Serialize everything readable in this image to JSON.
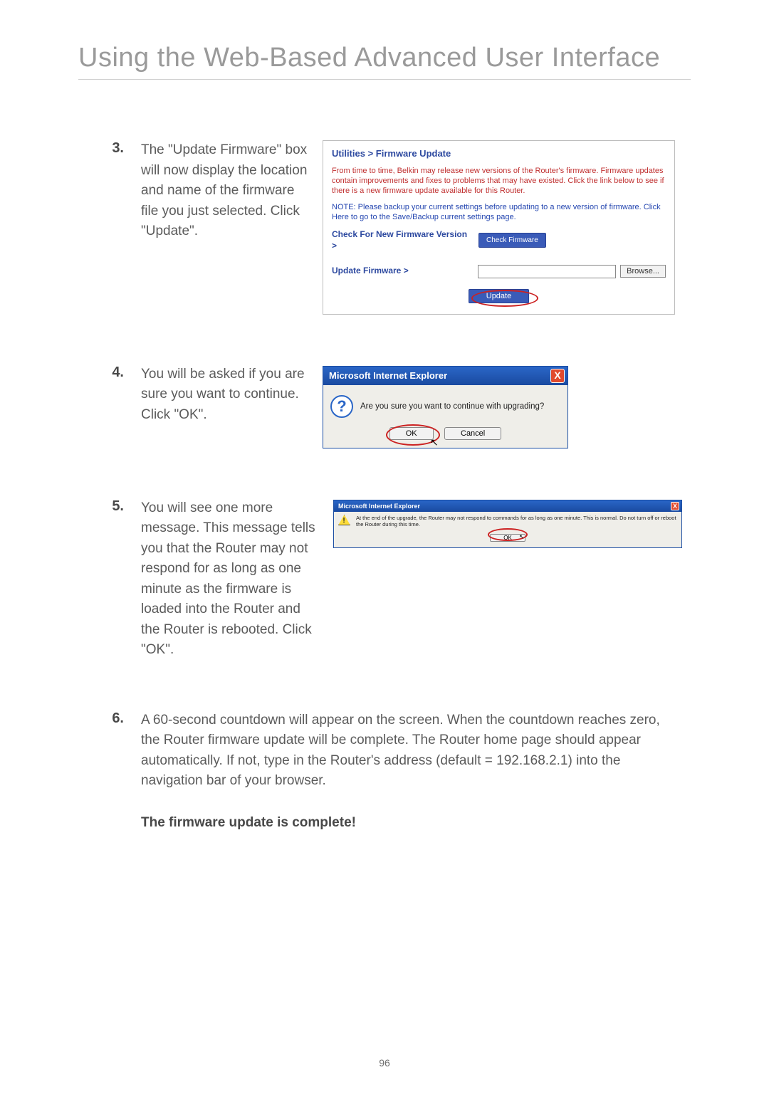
{
  "title": "Using the Web-Based Advanced User Interface",
  "page_number": "96",
  "steps": {
    "s3": {
      "num": "3.",
      "text": "The \"Update Firmware\" box will now display the location and name of the firmware file you just selected. Click \"Update\"."
    },
    "s4": {
      "num": "4.",
      "text": "You will be asked if you are sure you want to continue. Click \"OK\"."
    },
    "s5": {
      "num": "5.",
      "text": "You will see one more message. This message tells you that the Router may not respond for as long as one minute as the firmware is loaded into the Router and the Router is rebooted. Click \"OK\"."
    },
    "s6": {
      "num": "6.",
      "text": "A 60-second countdown will appear on the screen. When the countdown reaches zero, the Router firmware update will be complete. The Router home page should appear automatically. If not, type in the Router's address (default = 192.168.2.1) into the navigation bar of your browser."
    }
  },
  "complete_text": "The firmware update is complete!",
  "fw_panel": {
    "title": "Utilities > Firmware Update",
    "p1": "From time to time, Belkin may release new versions of the Router's firmware. Firmware updates contain improvements and fixes to problems that may have existed. Click the link below to see if there is a new firmware update available for this Router.",
    "p2": "NOTE: Please backup your current settings before updating to a new version of firmware. Click Here to go to the Save/Backup current settings page.",
    "check_label": "Check For New Firmware Version >",
    "check_button": "Check Firmware",
    "update_label": "Update Firmware >",
    "browse_button": "Browse...",
    "update_button": "Update"
  },
  "ie_confirm": {
    "title": "Microsoft Internet Explorer",
    "close": "X",
    "icon": "?",
    "message": "Are you sure you want to continue with upgrading?",
    "ok": "OK",
    "cancel": "Cancel"
  },
  "ie_warn": {
    "title": "Microsoft Internet Explorer",
    "close": "X",
    "message": "At the end of the upgrade, the Router may not respond to commands for as long as one minute. This is normal. Do not turn off or reboot the Router during this time.",
    "ok": "OK"
  }
}
